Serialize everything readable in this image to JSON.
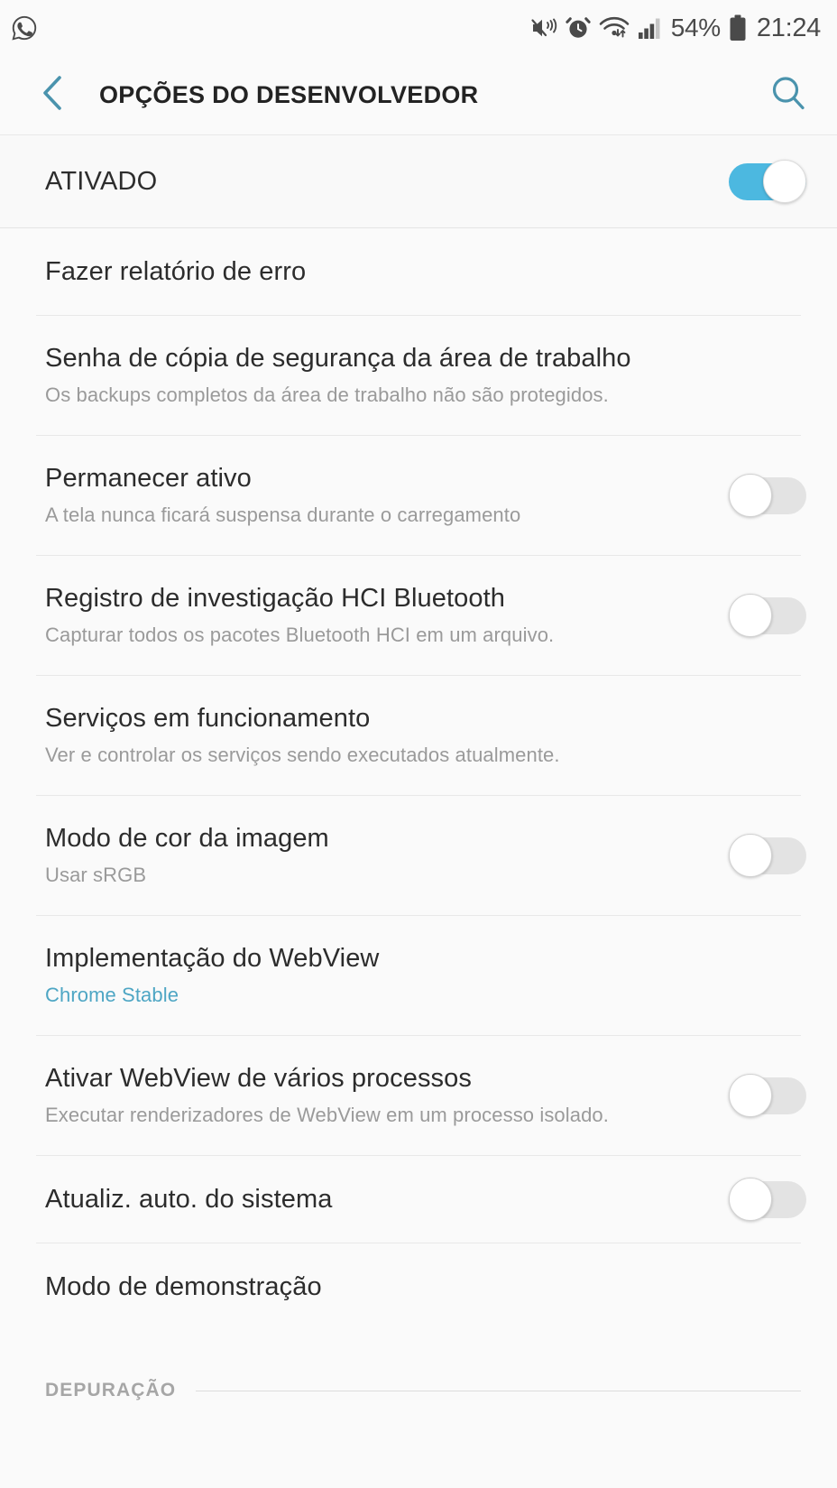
{
  "statusbar": {
    "notification_icon": "whatsapp-icon",
    "icons": [
      "mute-vibrate-icon",
      "alarm-icon",
      "wifi-icon",
      "signal-bars-icon"
    ],
    "battery_percent": "54%",
    "battery_icon": "battery-icon",
    "clock": "21:24"
  },
  "appbar": {
    "back_icon": "chevron-left-icon",
    "title": "OPÇÕES DO DESENVOLVEDOR",
    "search_icon": "search-icon",
    "accent_color": "#4a93ad"
  },
  "master": {
    "label": "ATIVADO",
    "state": "on",
    "on_color": "#4cb8e0"
  },
  "rows": [
    {
      "title": "Fazer relatório de erro",
      "subtitle": "",
      "control": "none",
      "state": ""
    },
    {
      "title": "Senha de cópia de segurança da área de trabalho",
      "subtitle": "Os backups completos da área de trabalho não são protegidos.",
      "control": "none",
      "state": ""
    },
    {
      "title": "Permanecer ativo",
      "subtitle": "A tela nunca ficará suspensa durante o carregamento",
      "control": "switch",
      "state": "off"
    },
    {
      "title": "Registro de investigação HCI Bluetooth",
      "subtitle": "Capturar todos os pacotes Bluetooth HCI em um arquivo.",
      "control": "switch",
      "state": "off"
    },
    {
      "title": "Serviços em funcionamento",
      "subtitle": "Ver e controlar os serviços sendo executados atualmente.",
      "control": "none",
      "state": ""
    },
    {
      "title": "Modo de cor da imagem",
      "subtitle": "Usar sRGB",
      "control": "switch",
      "state": "off"
    },
    {
      "title": "Implementação do WebView",
      "subtitle": "Chrome Stable",
      "subtitle_accent": true,
      "control": "none",
      "state": ""
    },
    {
      "title": "Ativar WebView de vários processos",
      "subtitle": "Executar renderizadores de WebView em um processo isolado.",
      "control": "switch",
      "state": "off"
    },
    {
      "title": "Atualiz. auto. do sistema",
      "subtitle": "",
      "control": "switch",
      "state": "off"
    },
    {
      "title": "Modo de demonstração",
      "subtitle": "",
      "control": "none",
      "state": ""
    }
  ],
  "section": {
    "label": "DEPURAÇÃO"
  }
}
